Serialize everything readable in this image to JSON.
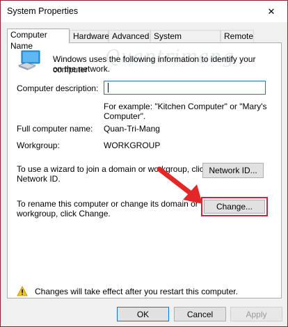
{
  "window": {
    "title": "System Properties",
    "close_glyph": "✕",
    "accent": "#8b2330"
  },
  "tabs": [
    {
      "label": "Computer Name",
      "active": true
    },
    {
      "label": "Hardware",
      "active": false
    },
    {
      "label": "Advanced",
      "active": false
    },
    {
      "label": "System Protection",
      "active": false
    },
    {
      "label": "Remote",
      "active": false
    }
  ],
  "content": {
    "intro_line1": "Windows uses the following information to identify your computer",
    "intro_line2": "on the network.",
    "computer_icon": "computer-monitor-icon",
    "description_label": "Computer description:",
    "description_value": "",
    "example_line1": "For example: \"Kitchen Computer\" or \"Mary's",
    "example_line2": "Computer\".",
    "full_name_label": "Full computer name:",
    "full_name_value": "Quan-Tri-Mang",
    "workgroup_label": "Workgroup:",
    "workgroup_value": "WORKGROUP",
    "wizard_line1": "To use a wizard to join a domain or workgroup, click",
    "wizard_line2": "Network ID.",
    "network_id_button": "Network ID...",
    "rename_line1": "To rename this computer or change its domain or",
    "rename_line2": "workgroup, click Change.",
    "change_button": "Change...",
    "warning_icon": "warning-icon",
    "warning_text": "Changes will take effect after you restart this computer.",
    "watermark_text": "Quantrimang",
    "highlight_color": "#c6283c",
    "arrow_color": "#e32626"
  },
  "footer": {
    "ok": "OK",
    "cancel": "Cancel",
    "apply": "Apply"
  }
}
